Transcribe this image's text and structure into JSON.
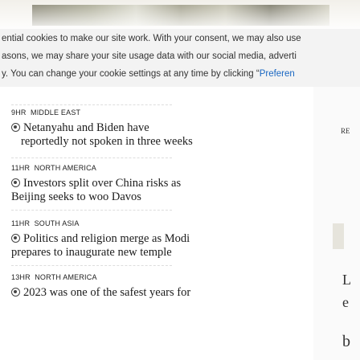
{
  "cookie_banner": {
    "line1": "ential cookies to make our site work. With your consent, we may also use",
    "line2": "asons, we may share your site usage data with our social media, adverti",
    "line3_prefix": "y. You can change your cookie settings at any time by clicking “",
    "line3_link": "Preferen"
  },
  "feed": {
    "items": [
      {
        "time": "9HR",
        "region": "MIDDLE EAST",
        "line1": "Netanyahu and Biden have",
        "line2": "reportedly not spoken in three weeks"
      },
      {
        "time": "11HR",
        "region": "NORTH AMERICA",
        "line1": "Investors split over China risks as",
        "line2": "Beijing seeks to woo Davos"
      },
      {
        "time": "11HR",
        "region": "SOUTH ASIA",
        "line1": "Politics and religion merge as Modi",
        "line2": "prepares to inaugurate new temple"
      },
      {
        "time": "13HR",
        "region": "NORTH AMERICA",
        "line1": "2023 was one of the safest years for",
        "line2": ""
      }
    ]
  },
  "side": {
    "label_re": "RE",
    "letter_l": "L",
    "letter_e": "e",
    "letter_b": "b"
  },
  "colors": {
    "link": "#1a67c2",
    "cookie_bg": "#f3f3f3"
  }
}
